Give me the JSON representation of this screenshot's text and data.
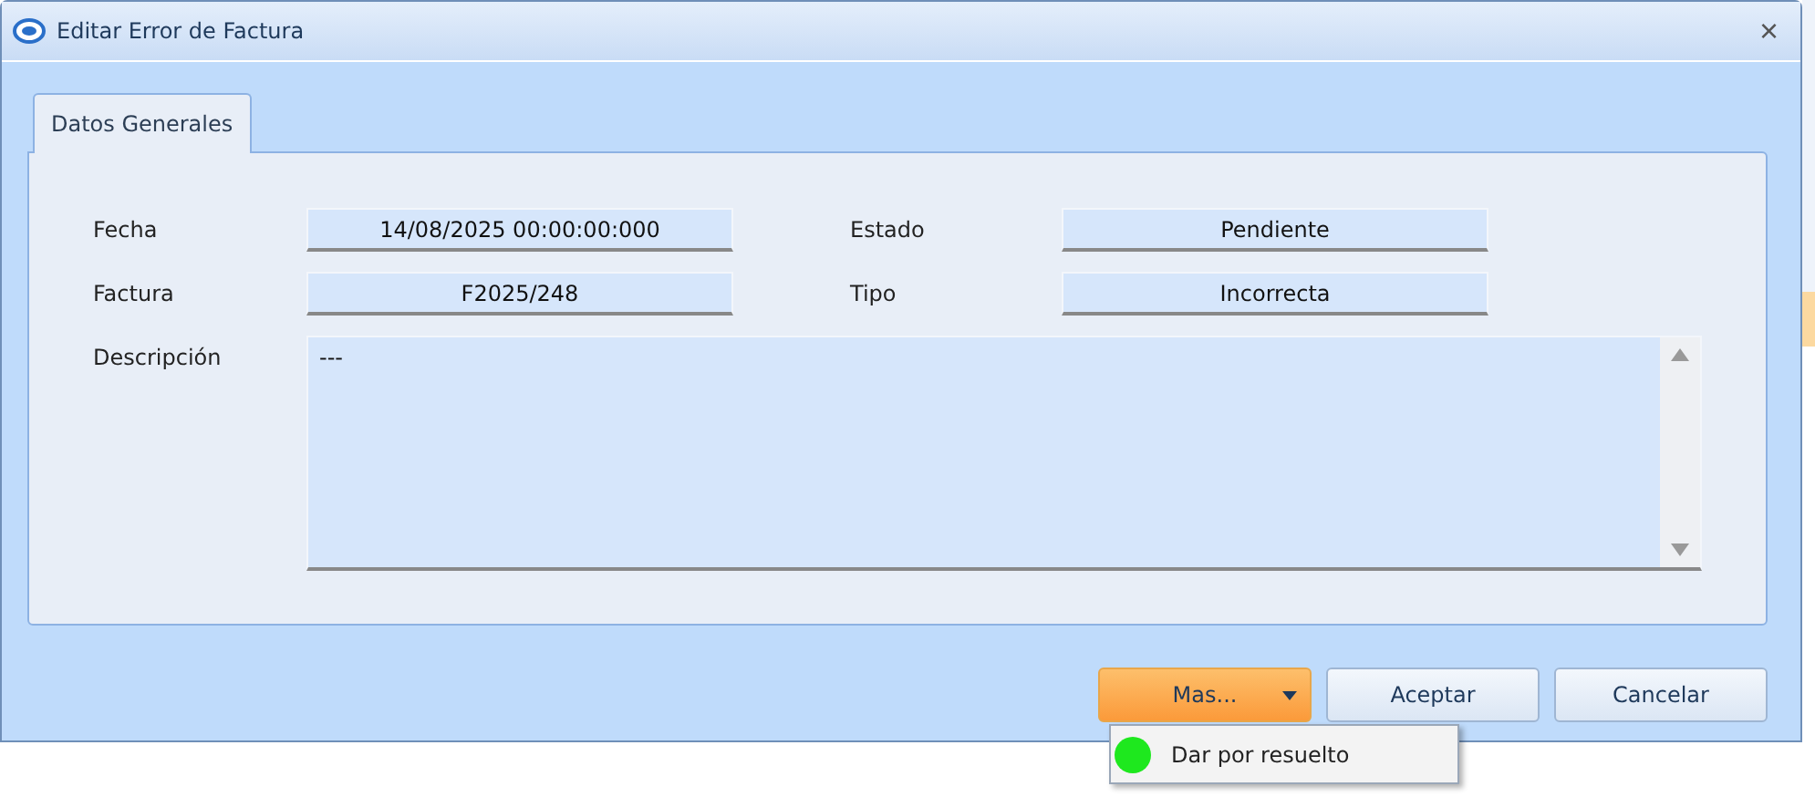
{
  "window": {
    "title": "Editar Error de Factura",
    "close": "×"
  },
  "tabs": [
    {
      "label": "Datos Generales",
      "selected": true
    }
  ],
  "fields": [
    {
      "label": "Fecha",
      "value": "14/08/2025 00:00:00:000"
    },
    {
      "label": "Estado",
      "value": "Pendiente"
    },
    {
      "label": "Factura",
      "value": "F2025/248"
    },
    {
      "label": "Tipo",
      "value": "Incorrecta"
    }
  ],
  "description": {
    "label": "Descripción",
    "value": "---"
  },
  "buttons": [
    {
      "label": "Mas...",
      "kind": "dropdown",
      "expanded": true
    },
    {
      "label": "Aceptar",
      "kind": "plain"
    },
    {
      "label": "Cancelar",
      "kind": "plain"
    }
  ],
  "menu": [
    {
      "label": "Dar por resuelto",
      "color": "#1ee81e"
    }
  ]
}
